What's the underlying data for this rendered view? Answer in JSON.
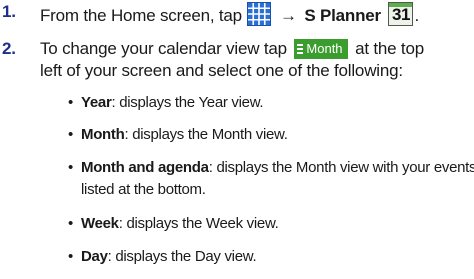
{
  "steps": [
    {
      "number": "1.",
      "text_before": "From the Home screen, tap",
      "apps_icon": "apps-grid-icon",
      "arrow": "→",
      "app_name": "S Planner",
      "calendar_icon": {
        "name": "s-planner-calendar-icon",
        "number": "31"
      },
      "text_after": "."
    },
    {
      "number": "2.",
      "text_before": "To change your calendar view tap",
      "button_label": "Month",
      "button_icon": "menu-lines-icon",
      "text_after": "at the top",
      "line2": "left of your screen and select one of the following:"
    }
  ],
  "options": [
    {
      "bullet": "•",
      "term": "Year",
      "description": ": displays the Year view."
    },
    {
      "bullet": "•",
      "term": "Month",
      "description": ": displays the Month view."
    },
    {
      "bullet": "•",
      "term": "Month and agenda",
      "description": ": displays the Month view with your events",
      "continuation": "listed at the bottom."
    },
    {
      "bullet": "•",
      "term": "Week",
      "description": ": displays the Week view."
    },
    {
      "bullet": "•",
      "term": "Day",
      "description": ": displays the Day view."
    }
  ],
  "colors": {
    "step_number": "#1f2d8c",
    "apps_icon_blue": "#2a6fd6",
    "month_button_green": "#3a9d2d",
    "calendar_icon_green": "#5bb04a"
  }
}
